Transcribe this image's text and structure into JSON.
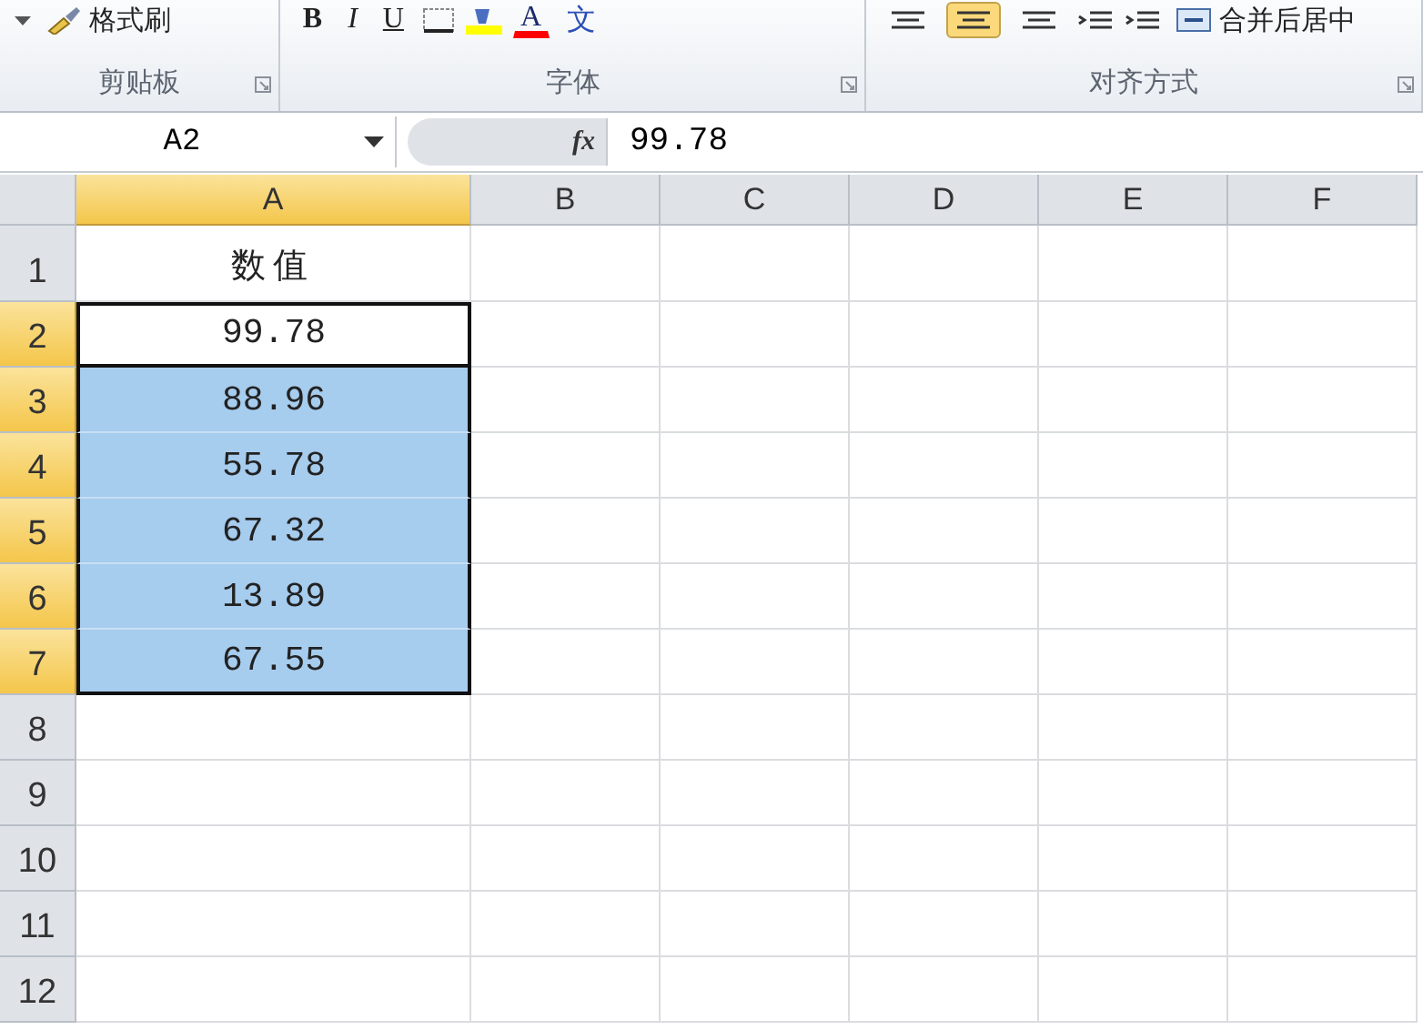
{
  "ribbon": {
    "groups": [
      {
        "label": "剪贴板",
        "tools": [
          {
            "kind": "caret"
          },
          {
            "kind": "brush",
            "label": "格式刷"
          }
        ]
      },
      {
        "label": "字体",
        "tools": [
          {
            "kind": "bold",
            "label": "B"
          },
          {
            "kind": "italic",
            "label": "I"
          },
          {
            "kind": "underline",
            "label": "U"
          },
          {
            "kind": "border"
          },
          {
            "kind": "fill",
            "color": "#ffff00"
          },
          {
            "kind": "fontcolor",
            "label": "A",
            "color": "#ff0000"
          },
          {
            "kind": "phonetic",
            "label": "文"
          }
        ]
      },
      {
        "label": "对齐方式",
        "tools": [
          {
            "kind": "align",
            "selected": false
          },
          {
            "kind": "align",
            "selected": true
          },
          {
            "kind": "align",
            "selected": false
          },
          {
            "kind": "indent"
          },
          {
            "kind": "indent"
          },
          {
            "kind": "merge",
            "label": "合并后居中"
          }
        ]
      }
    ]
  },
  "formula_bar": {
    "name_box": "A2",
    "fx": "fx",
    "value": "99.78"
  },
  "sheet": {
    "columns": [
      {
        "label": "A",
        "selected": true
      },
      {
        "label": "B",
        "selected": false
      },
      {
        "label": "C",
        "selected": false
      },
      {
        "label": "D",
        "selected": false
      },
      {
        "label": "E",
        "selected": false
      },
      {
        "label": "F",
        "selected": false
      }
    ],
    "rows": [
      {
        "label": "1",
        "selected": false,
        "active": false,
        "a": "数值"
      },
      {
        "label": "2",
        "selected": true,
        "active": true,
        "a": "99.78"
      },
      {
        "label": "3",
        "selected": true,
        "active": false,
        "a": "88.96"
      },
      {
        "label": "4",
        "selected": true,
        "active": false,
        "a": "55.78"
      },
      {
        "label": "5",
        "selected": true,
        "active": false,
        "a": "67.32"
      },
      {
        "label": "6",
        "selected": true,
        "active": false,
        "a": "13.89"
      },
      {
        "label": "7",
        "selected": true,
        "active": false,
        "a": "67.55"
      },
      {
        "label": "8",
        "selected": false,
        "active": false
      },
      {
        "label": "9",
        "selected": false,
        "active": false
      },
      {
        "label": "10",
        "selected": false,
        "active": false
      },
      {
        "label": "11",
        "selected": false,
        "active": false
      },
      {
        "label": "12",
        "selected": false,
        "active": false
      }
    ]
  }
}
